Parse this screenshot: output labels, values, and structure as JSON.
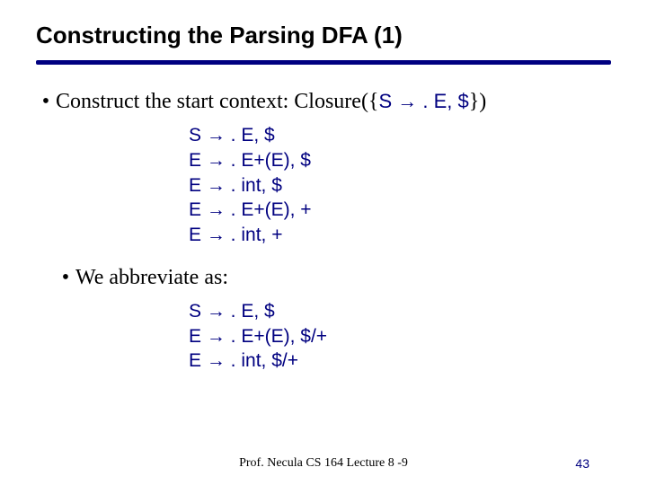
{
  "title": "Constructing the Parsing DFA (1)",
  "bullet1_lead": "Construct the start context: Closure({",
  "bullet1_ctx": "S → . E, $",
  "bullet1_tail": "})",
  "items1": [
    "S → . E, $",
    "E → . E+(E), $",
    "E → . int, $",
    "E → . E+(E), +",
    "E → . int, +"
  ],
  "bullet2": "We abbreviate as:",
  "items2": [
    "S → . E, $",
    "E → . E+(E), $/+",
    "E → . int, $/+"
  ],
  "footer": "Prof. Necula  CS 164  Lecture 8 -9",
  "page": "43"
}
